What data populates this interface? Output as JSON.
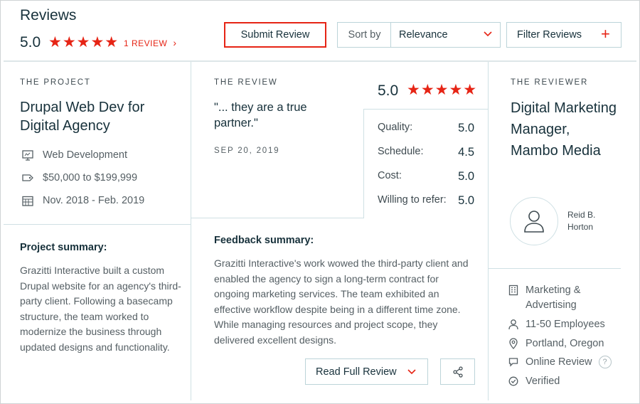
{
  "header": {
    "title": "Reviews",
    "overall_rating": "5.0",
    "stars": "★★★★★",
    "review_count": "1 REVIEW",
    "count_chevron": "›",
    "submit_label": "Submit Review",
    "sort_label": "Sort by",
    "sort_value": "Relevance",
    "filter_label": "Filter Reviews",
    "filter_plus": "+"
  },
  "project": {
    "section_label": "THE PROJECT",
    "title": "Drupal Web Dev for Digital Agency",
    "service": "Web Development",
    "budget": "$50,000 to $199,999",
    "dates": "Nov. 2018 - Feb. 2019",
    "summary_heading": "Project summary:",
    "summary": "Grazitti Interactive built a custom Drupal website for an agency's third-party client. Following a basecamp structure, the team worked to modernize the business through updated designs and functionality."
  },
  "review": {
    "section_label": "THE REVIEW",
    "quote": "\"... they are a true partner.\"",
    "date": "SEP 20, 2019",
    "rating": "5.0",
    "stars": "★★★★★",
    "scores": [
      {
        "label": "Quality:",
        "value": "5.0"
      },
      {
        "label": "Schedule:",
        "value": "4.5"
      },
      {
        "label": "Cost:",
        "value": "5.0"
      },
      {
        "label": "Willing to refer:",
        "value": "5.0"
      }
    ],
    "feedback_heading": "Feedback summary:",
    "feedback": "Grazitti Interactive's work wowed the third-party client and enabled the agency to sign a long-term contract for ongoing marketing services. The team exhibited an effective workflow despite being in a different time zone. While managing resources and project scope, they delivered excellent designs.",
    "read_full_label": "Read Full Review"
  },
  "reviewer": {
    "section_label": "THE REVIEWER",
    "title": "Digital Marketing Manager, Mambo Media",
    "name": "Reid B. Horton",
    "industry": "Marketing & Advertising",
    "size": "11-50 Employees",
    "location": "Portland, Oregon",
    "review_type": "Online Review",
    "verified": "Verified",
    "help_mark": "?"
  },
  "colors": {
    "accent_red": "#e62415",
    "divider": "#cfe0e4",
    "text_dark": "#17313b"
  }
}
